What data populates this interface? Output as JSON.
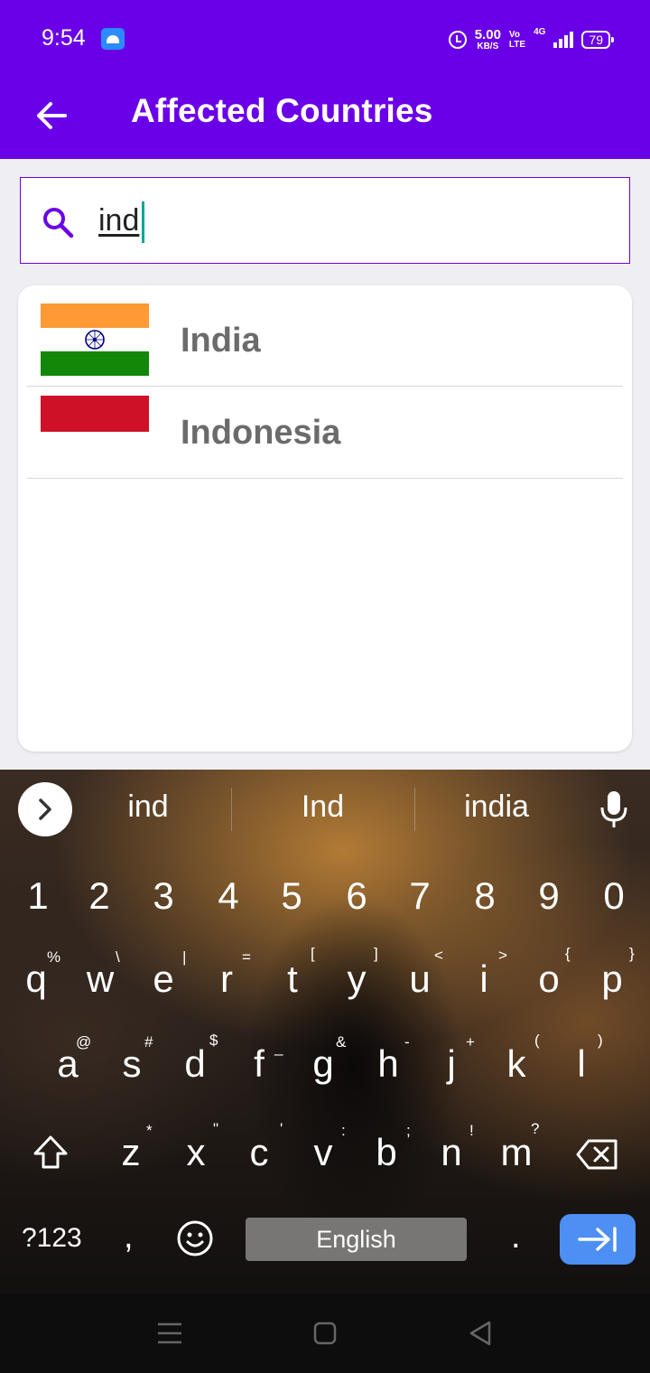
{
  "status_bar": {
    "time": "9:54",
    "speed_value": "5.00",
    "speed_unit": "KB/S",
    "volte_top": "Vo",
    "volte_bottom": "LTE",
    "network": "4G",
    "battery": "79"
  },
  "app_bar": {
    "title": "Affected Countries",
    "back_icon": "arrow-back-icon"
  },
  "search": {
    "query": "ind",
    "icon": "search-icon"
  },
  "countries": [
    {
      "name": "India",
      "flag": "india-flag"
    },
    {
      "name": "Indonesia",
      "flag": "indonesia-flag"
    }
  ],
  "keyboard": {
    "suggestions": [
      "ind",
      "Ind",
      "india"
    ],
    "number_row": [
      "1",
      "2",
      "3",
      "4",
      "5",
      "6",
      "7",
      "8",
      "9",
      "0"
    ],
    "row_q": [
      "q",
      "w",
      "e",
      "r",
      "t",
      "y",
      "u",
      "i",
      "o",
      "p"
    ],
    "row_q_hints": [
      "%",
      "\\",
      "|",
      "=",
      "[",
      "]",
      "<",
      ">",
      "{",
      "}"
    ],
    "row_a": [
      "a",
      "s",
      "d",
      "f",
      "g",
      "h",
      "j",
      "k",
      "l"
    ],
    "row_a_hints": [
      "@",
      "#",
      "$",
      "_",
      "&",
      "-",
      "+",
      "(",
      ")"
    ],
    "row_z": [
      "z",
      "x",
      "c",
      "v",
      "b",
      "n",
      "m"
    ],
    "row_z_hints": [
      "*",
      "\"",
      "'",
      ":",
      ";",
      "!",
      "?"
    ],
    "symbols_label": "?123",
    "comma": ",",
    "space_label": "English",
    "period": "."
  },
  "colors": {
    "primary": "#6a00e8",
    "enter_key": "#4d8ff2",
    "caret": "#00a59b"
  }
}
